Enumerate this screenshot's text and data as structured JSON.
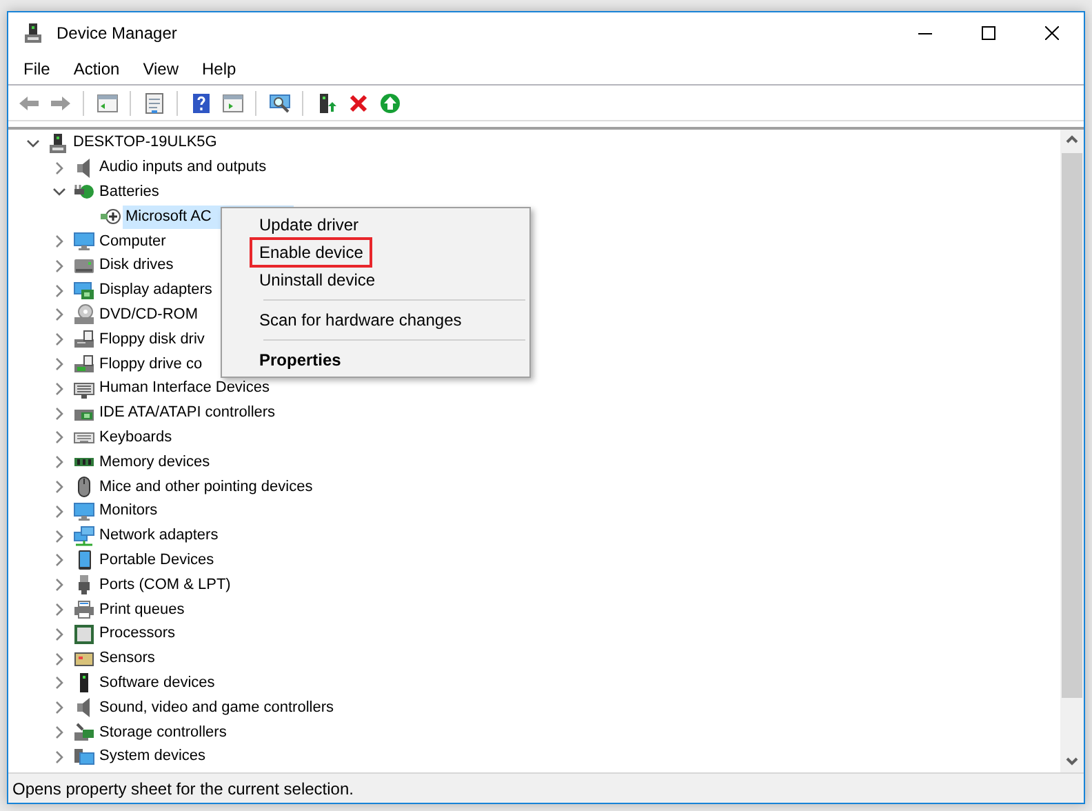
{
  "window": {
    "title": "Device Manager"
  },
  "menu_bar": [
    "File",
    "Action",
    "View",
    "Help"
  ],
  "tree": [
    {
      "label": "DESKTOP-19ULK5G",
      "expanded": true,
      "selected": false,
      "children": [
        {
          "label": "Audio inputs and outputs",
          "expanded": false,
          "selected": false
        },
        {
          "label": "Batteries",
          "expanded": true,
          "selected": false,
          "children": [
            {
              "label": "Microsoft AC",
              "selected": true
            }
          ]
        },
        {
          "label": "Computer",
          "expanded": false,
          "selected": false
        },
        {
          "label": "Disk drives",
          "expanded": false,
          "selected": false
        },
        {
          "label": "Display adapters",
          "expanded": false,
          "selected": false
        },
        {
          "label": "DVD/CD-ROM",
          "expanded": false,
          "selected": false
        },
        {
          "label": "Floppy disk driv",
          "expanded": false,
          "selected": false
        },
        {
          "label": "Floppy drive co",
          "expanded": false,
          "selected": false
        },
        {
          "label": "Human Interface Devices",
          "expanded": false,
          "selected": false
        },
        {
          "label": "IDE ATA/ATAPI controllers",
          "expanded": false,
          "selected": false
        },
        {
          "label": "Keyboards",
          "expanded": false,
          "selected": false
        },
        {
          "label": "Memory devices",
          "expanded": false,
          "selected": false
        },
        {
          "label": "Mice and other pointing devices",
          "expanded": false,
          "selected": false
        },
        {
          "label": "Monitors",
          "expanded": false,
          "selected": false
        },
        {
          "label": "Network adapters",
          "expanded": false,
          "selected": false
        },
        {
          "label": "Portable Devices",
          "expanded": false,
          "selected": false
        },
        {
          "label": "Ports (COM & LPT)",
          "expanded": false,
          "selected": false
        },
        {
          "label": "Print queues",
          "expanded": false,
          "selected": false
        },
        {
          "label": "Processors",
          "expanded": false,
          "selected": false
        },
        {
          "label": "Sensors",
          "expanded": false,
          "selected": false
        },
        {
          "label": "Software devices",
          "expanded": false,
          "selected": false
        },
        {
          "label": "Sound, video and game controllers",
          "expanded": false,
          "selected": false
        },
        {
          "label": "Storage controllers",
          "expanded": false,
          "selected": false
        },
        {
          "label": "System devices",
          "expanded": false,
          "selected": false
        }
      ]
    }
  ],
  "context_menu": [
    {
      "kind": "item",
      "label": "Update driver",
      "default": false,
      "highlighted": false
    },
    {
      "kind": "item",
      "label": "Enable device",
      "default": false,
      "highlighted": true
    },
    {
      "kind": "item",
      "label": "Uninstall device",
      "default": false,
      "highlighted": false
    },
    {
      "kind": "separator"
    },
    {
      "kind": "item",
      "label": "Scan for hardware changes",
      "default": false,
      "highlighted": false
    },
    {
      "kind": "separator"
    },
    {
      "kind": "item",
      "label": "Properties",
      "default": true,
      "highlighted": false
    }
  ],
  "status_bar": "Opens property sheet for the current selection."
}
